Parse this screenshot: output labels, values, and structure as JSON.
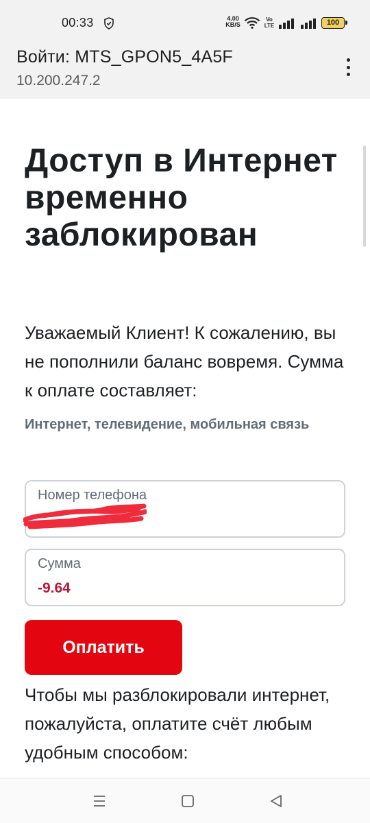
{
  "status_bar": {
    "time": "00:33",
    "net_speed_value": "4.00",
    "net_speed_unit": "KB/S",
    "volte_top": "Vo",
    "volte_bottom": "LTE",
    "battery_level": "100",
    "icons": [
      "vpn-shield-icon",
      "wifi-icon",
      "signal-icon",
      "signal-icon",
      "battery-icon"
    ]
  },
  "header": {
    "title": "Войти: MTS_GPON5_4A5F",
    "url": "10.200.247.2",
    "menu_icon": "more-vert-icon"
  },
  "page": {
    "headline": "Доступ в Интернет временно заблокирован",
    "intro": "Уважаемый Клиент! К сожалению, вы не пополнили баланс вовремя. Сумма к оплате составляет:",
    "services": "Интернет, телевидение, мобильная связь",
    "phone_field": {
      "label": "Номер телефона",
      "value": ""
    },
    "sum_field": {
      "label": "Сумма",
      "value": "-9.64"
    },
    "pay_button": "Оплатить",
    "outro": "Чтобы мы разблокировали интернет, пожалуйста, оплатите счёт любым удобным способом:"
  },
  "colors": {
    "accent": "#e30611",
    "amount": "#b7173a",
    "muted": "#626c77",
    "text": "#1d2023"
  },
  "nav_bar": {
    "icons": [
      "menu-icon",
      "home-icon",
      "back-icon"
    ]
  }
}
